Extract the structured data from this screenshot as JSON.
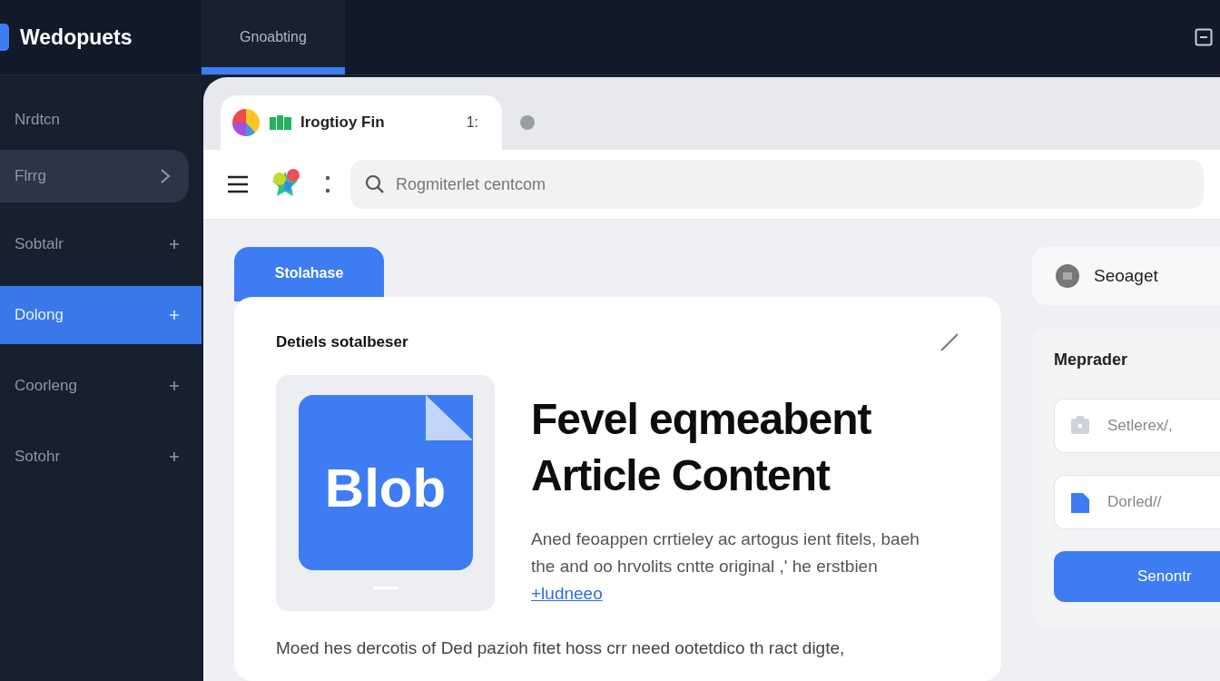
{
  "header": {
    "brand": "Wedopuets",
    "tabs": [
      {
        "label": "Gnoabting",
        "selected": true
      }
    ]
  },
  "sidebar": {
    "items": [
      {
        "label": "Nrdtcn",
        "kind": "heading",
        "selected": false
      },
      {
        "label": "Flrrg",
        "kind": "group",
        "selected": false
      },
      {
        "label": "Sobtalr",
        "kind": "plus",
        "selected": false
      },
      {
        "label": "Dolong",
        "kind": "plus",
        "selected": true
      },
      {
        "label": "Coorleng",
        "kind": "plus",
        "selected": false
      },
      {
        "label": "Sotohr",
        "kind": "plus",
        "selected": false
      }
    ]
  },
  "browser": {
    "tabs": [
      {
        "title": "Irogtioy Fin",
        "mark": "1:",
        "selected": true
      },
      {
        "selected": false
      }
    ],
    "search": {
      "placeholder": "Rogmiterlet centcom"
    }
  },
  "content": {
    "section_tab": "Stolahase",
    "card_title": "Detiels sotalbeser",
    "preview_label": "Blob",
    "headline": [
      "Fevel eqmeabent",
      "Article Content"
    ],
    "description": "Aned feoappen crrtieley ac artogus ient fitels, baeh the and oo hrvolits cntte original ,' he erstbien",
    "link": "+ludneeo",
    "body": "Moed hes dercotis of Ded pazioh fitet hoss crr need ootetdico th ract digte,"
  },
  "side": {
    "chip": "Seoaget",
    "form_title": "Meprader",
    "fields": [
      {
        "placeholder": "Setlerex/,",
        "kind": "box"
      },
      {
        "placeholder": "Dorled//",
        "kind": "doc"
      }
    ],
    "button": "Senontr"
  }
}
